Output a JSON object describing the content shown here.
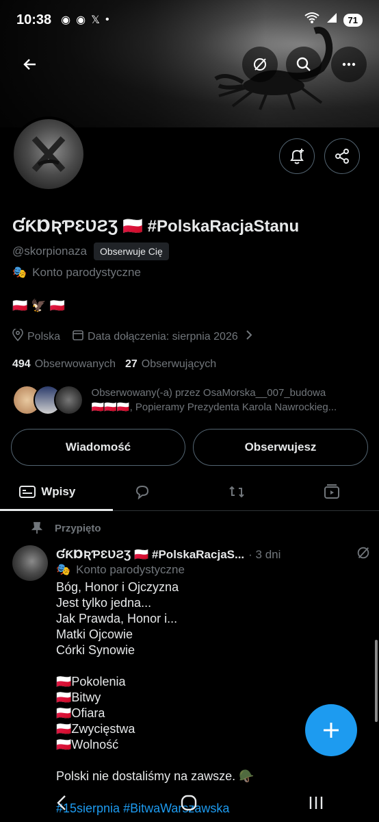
{
  "status_bar": {
    "time": "10:38",
    "battery": "71"
  },
  "profile": {
    "name": "ƓƘⱰƦƤƐƲƧƷ 🇵🇱 #PolskaRacjaStanu",
    "handle": "@skorpionaza",
    "follows_you": "Obserwuje Cię",
    "parody_label": "Konto parodystyczne",
    "bio": "🇵🇱 🦅 🇵🇱",
    "location": "Polska",
    "joined": "Data dołączenia: sierpnia 2026",
    "following_count": "494",
    "following_label": "Obserwowanych",
    "followers_count": "27",
    "followers_label": "Obserwujących",
    "followed_by_line1": "Obserwowany(-a) przez OsaMorska__007_budowa",
    "followed_by_line2": "🇵🇱🇵🇱🇵🇱, Popieramy Prezydenta Karola Nawrockieg..."
  },
  "buttons": {
    "message": "Wiadomość",
    "following": "Obserwujesz"
  },
  "tabs": [
    {
      "label": "Wpisy"
    }
  ],
  "pinned_label": "Przypięto",
  "post": {
    "author": "ƓƘⱰƦƤƐƲƧƷ 🇵🇱 #PolskaRacjaS...",
    "time": "· 3 dni",
    "parody_label": "Konto parodystyczne",
    "lines": [
      "Bóg, Honor i Ojczyzna",
      "Jest tylko jedna...",
      "Jak Prawda, Honor i...",
      "Matki Ojcowie",
      "Córki Synowie",
      "",
      "🇵🇱Pokolenia",
      "🇵🇱Bitwy",
      "🇵🇱Ofiara",
      "🇵🇱Zwycięstwa",
      "🇵🇱Wolność",
      "",
      "Polski nie dostaliśmy na zawsze. 🪖"
    ],
    "hashtags": "#15sierpnia #BitwaWarszawska"
  },
  "colors": {
    "accent": "#1d9bf0",
    "muted": "#71767b",
    "text": "#e7e9ea",
    "bg": "#000000"
  }
}
